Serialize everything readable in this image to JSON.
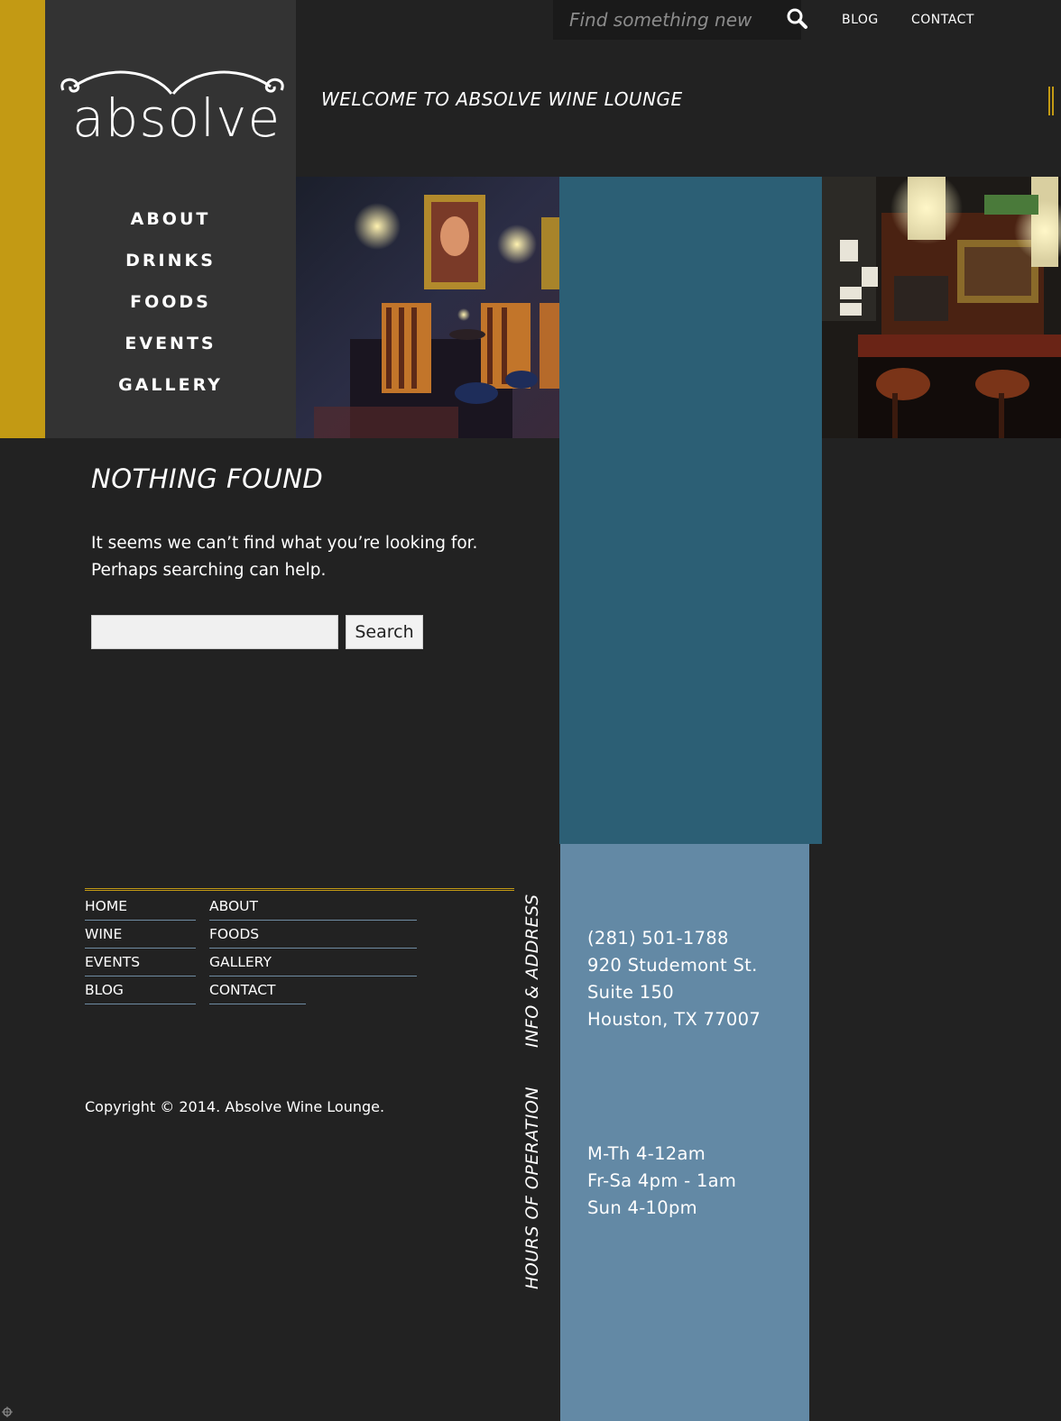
{
  "brand": {
    "logo_text": "absolve",
    "accent_color": "#c39a14",
    "panel_blue": "#2c5f75",
    "info_blue": "#6389a5"
  },
  "sidebar": {
    "items": [
      {
        "label": "ABOUT"
      },
      {
        "label": "DRINKS"
      },
      {
        "label": "FOODS"
      },
      {
        "label": "EVENTS"
      },
      {
        "label": "GALLERY"
      }
    ]
  },
  "header": {
    "search_placeholder": "Find something new",
    "search_icon": "search-icon",
    "links": [
      {
        "label": "BLOG"
      },
      {
        "label": "CONTACT"
      }
    ],
    "welcome": "WELCOME TO ABSOLVE WINE LOUNGE"
  },
  "main": {
    "title": "NOTHING FOUND",
    "message": "It seems we can’t find what you’re looking for. Perhaps searching can help.",
    "search_value": "",
    "search_button": "Search"
  },
  "footer": {
    "links_col1": [
      {
        "label": "HOME"
      },
      {
        "label": "WINE"
      },
      {
        "label": "EVENTS"
      },
      {
        "label": "BLOG"
      }
    ],
    "links_col2": [
      {
        "label": "ABOUT"
      },
      {
        "label": "FOODS"
      },
      {
        "label": "GALLERY"
      },
      {
        "label": "CONTACT"
      }
    ],
    "copyright": "Copyright © 2014. Absolve Wine Lounge.",
    "info_label": "INFO & ADDRESS",
    "hours_label": "HOURS OF OPERATION",
    "address": [
      "(281) 501-1788",
      "920 Studemont St.",
      "Suite 150",
      "Houston, TX 77007"
    ],
    "hours": [
      "M-Th 4-12am",
      "Fr-Sa 4pm - 1am",
      "Sun 4-10pm"
    ]
  }
}
